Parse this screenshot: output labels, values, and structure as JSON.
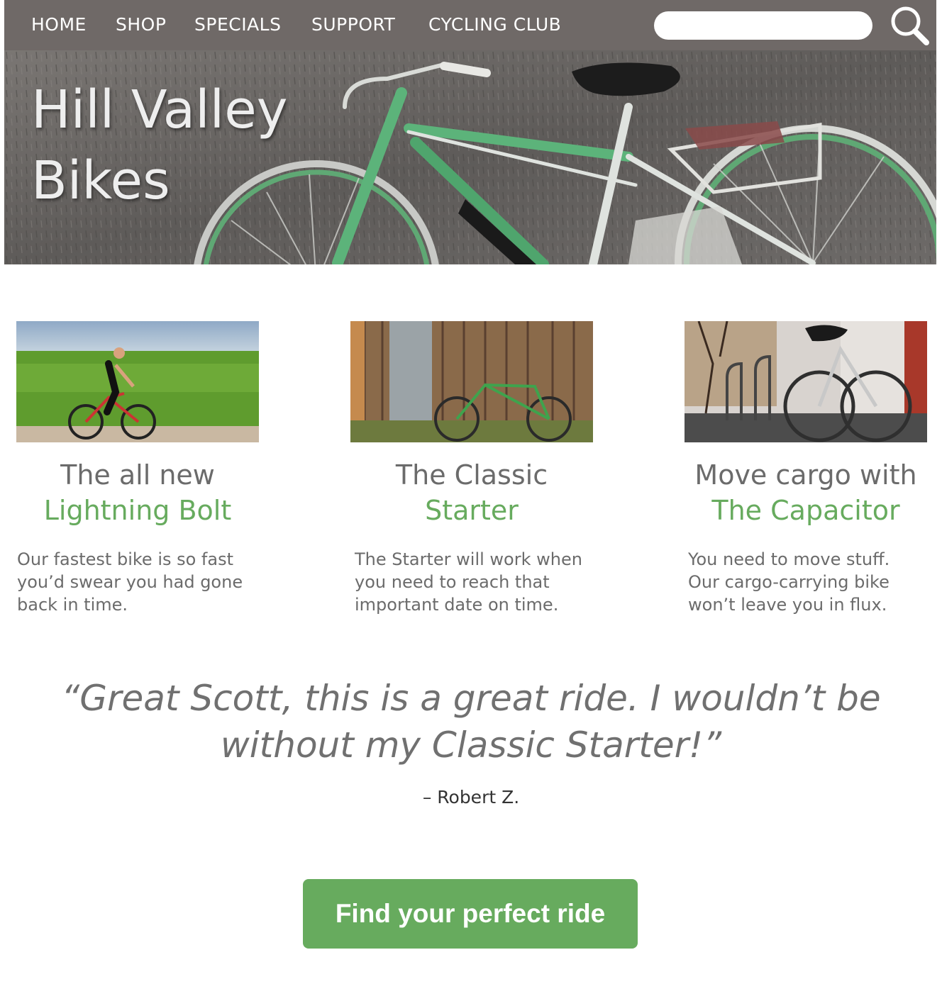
{
  "nav": {
    "items": [
      {
        "label": "HOME"
      },
      {
        "label": "SHOP"
      },
      {
        "label": "SPECIALS"
      },
      {
        "label": "SUPPORT"
      },
      {
        "label": "CYCLING CLUB"
      }
    ],
    "search_value": "",
    "search_icon": "magnifier-icon"
  },
  "hero": {
    "title": "Hill Valley\nBikes"
  },
  "cards": [
    {
      "heading_line1": "The all new",
      "heading_line2": "Lightning Bolt",
      "text": "Our fastest bike is so fast you’d swear you had gone back in time."
    },
    {
      "heading_line1": "The Classic",
      "heading_line2": "Starter",
      "text": "The Starter will work when you need to reach that important date on time."
    },
    {
      "heading_line1": "Move cargo with",
      "heading_line2": "The Capacitor",
      "text": "You need to move stuff. Our cargo-carrying bike won’t leave you in flux."
    }
  ],
  "testimonial": {
    "quote": "“Great Scott, this is a great ride. I wouldn’t be without my Classic Starter!”",
    "author": "– Robert Z."
  },
  "cta": {
    "label": "Find your perfect ride"
  },
  "colors": {
    "nav_bg": "#6f6967",
    "accent_green": "#67ab5e",
    "text_gray": "#6b6b6b"
  }
}
